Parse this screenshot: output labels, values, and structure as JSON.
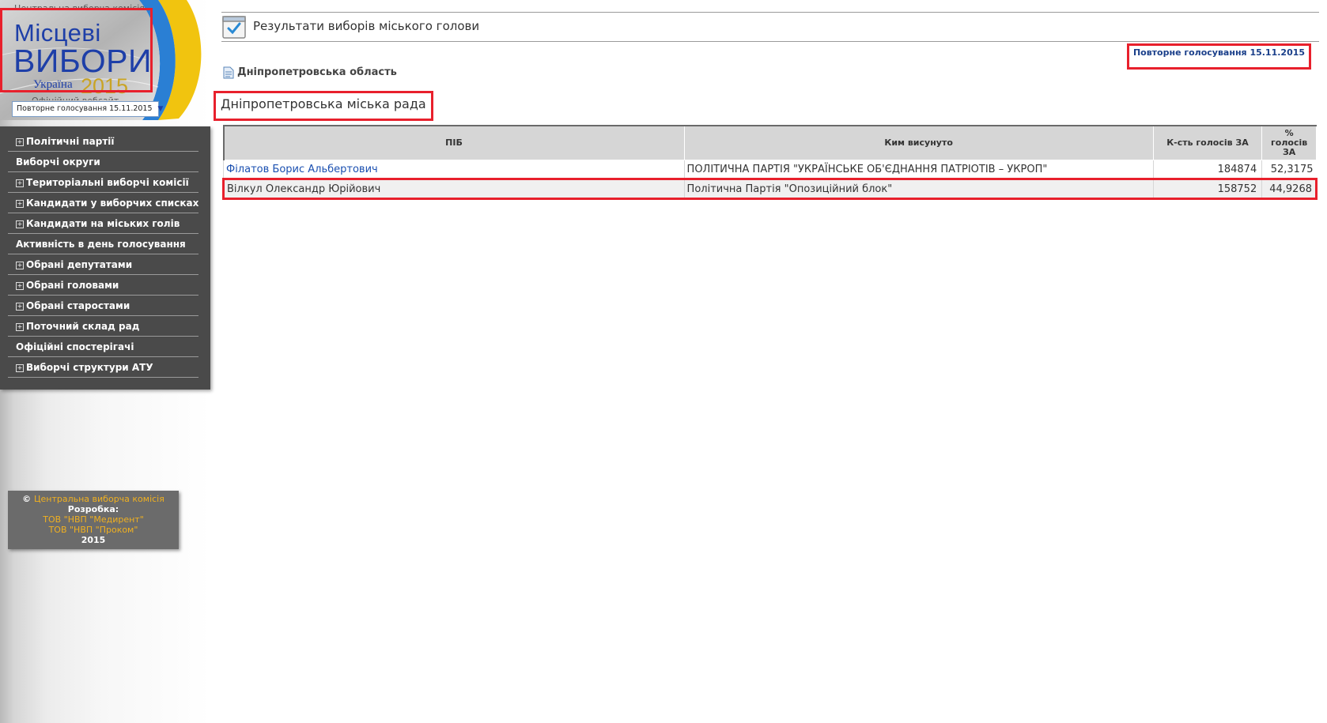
{
  "header": {
    "cvk_label": "Центральна виборча комісія",
    "logo_line1": "Місцеві",
    "logo_line2": "ВИБОРИ",
    "logo_country": "Україна",
    "logo_year": "2015",
    "logo_sub": "Офіційний вебсайт",
    "round_select_value": "Повторне голосування 15.11.2015"
  },
  "nav": {
    "items": [
      {
        "label": "Політичні партії",
        "expandable": true
      },
      {
        "label": "Виборчі округи",
        "expandable": false
      },
      {
        "label": "Територіальні виборчі комісії",
        "expandable": true
      },
      {
        "label": "Кандидати у виборчих списках",
        "expandable": true
      },
      {
        "label": "Кандидати на міських голів",
        "expandable": true
      },
      {
        "label": "Активність в день голосування",
        "expandable": false
      },
      {
        "label": "Обрані депутатами",
        "expandable": true
      },
      {
        "label": "Обрані головами",
        "expandable": true
      },
      {
        "label": "Обрані старостами",
        "expandable": true
      },
      {
        "label": "Поточний склад рад",
        "expandable": true
      },
      {
        "label": "Офіційні спостерігачі",
        "expandable": false
      },
      {
        "label": "Виборчі структури АТУ",
        "expandable": true
      }
    ]
  },
  "footer": {
    "copyright": "©",
    "cvk_link": "Центральна виборча комісія",
    "dev_label": "Розробка:",
    "dev1": "ТОВ \"НВП \"Медирент\"",
    "dev2": "ТОВ \"НВП \"Проком\"",
    "year": "2015"
  },
  "main": {
    "page_title": "Результати виборів міського голови",
    "round_link": "Повторне голосування 15.11.2015",
    "region": "Дніпропетровська область",
    "council": "Дніпропетровська міська рада",
    "table": {
      "headers": {
        "name": "ПІБ",
        "nominated_by": "Ким висунуто",
        "votes": "К-сть голосів ЗА",
        "percent": "% голосів ЗА"
      },
      "rows": [
        {
          "name": "Філатов Борис Альбертович",
          "nominated_by": "ПОЛІТИЧНА ПАРТІЯ \"УКРАЇНСЬКЕ ОБ'ЄДНАННЯ ПАТРІОТІВ – УКРОП\"",
          "votes": "184874",
          "percent": "52,3175"
        },
        {
          "name": "Вілкул Олександр Юрійович",
          "nominated_by": "Політична Партія \"Опозиційний блок\"",
          "votes": "158752",
          "percent": "44,9268"
        }
      ]
    }
  },
  "colors": {
    "accent_blue": "#1e3fa8",
    "nav_bg": "#4a4a4a",
    "highlight_red": "#e8202c",
    "year_gold": "#c9a425",
    "link_orange": "#f0b020"
  }
}
